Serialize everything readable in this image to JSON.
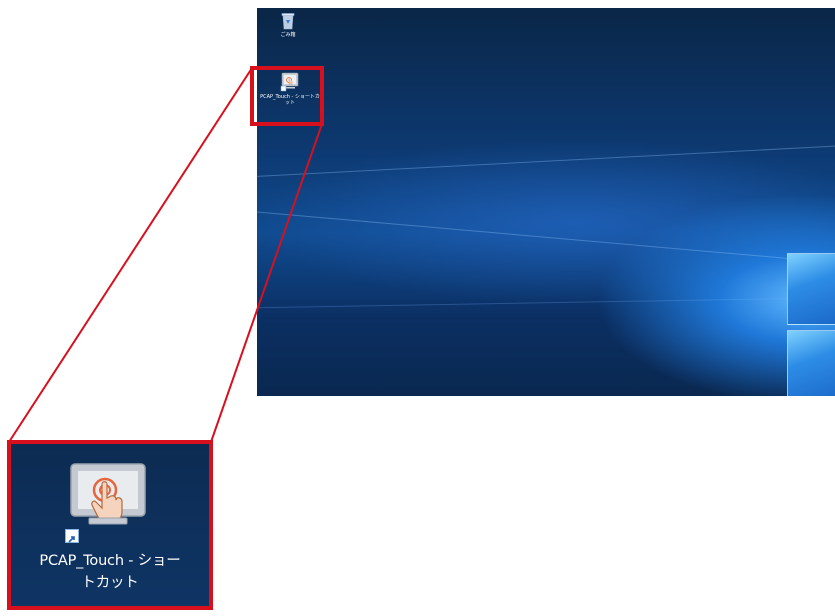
{
  "desktop": {
    "icons": [
      {
        "name": "recycle-bin",
        "label": "ごみ箱",
        "glyph": "recycle-bin-icon"
      },
      {
        "name": "pcap-touch-shortcut",
        "label": "PCAP_Touch - ショートカット",
        "glyph": "touch-screen-hand-icon"
      }
    ]
  },
  "zoom": {
    "label_line1": "PCAP_Touch - ショー",
    "label_line2": "トカット",
    "shortcut_overlay": "shortcut-arrow-icon"
  },
  "colors": {
    "highlight": "#d7101e",
    "desktop_blue": "#0d3a73",
    "accent_light_blue": "#5fb8ff",
    "touch_orange": "#e8643c"
  }
}
